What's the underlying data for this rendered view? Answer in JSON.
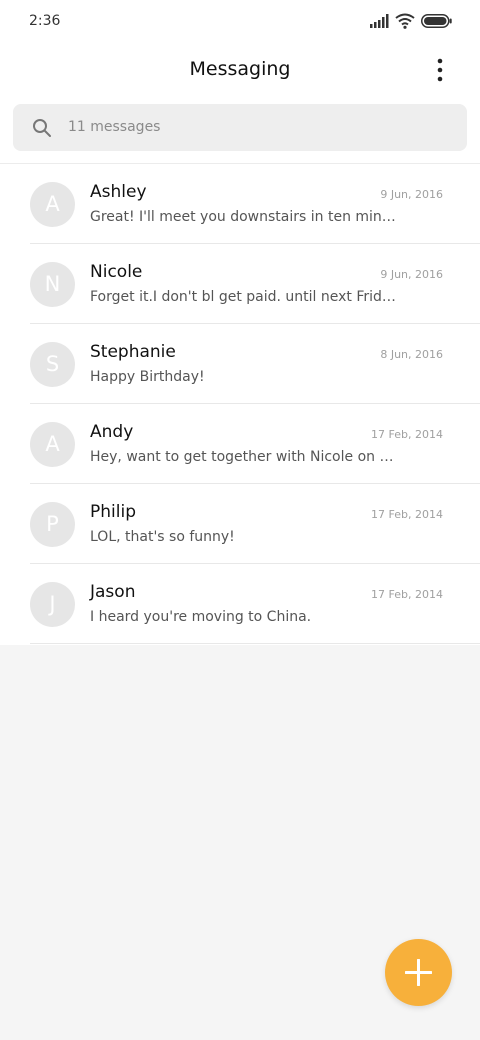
{
  "status_bar": {
    "time": "2:36"
  },
  "header": {
    "title": "Messaging",
    "more_icon": "more-vertical-icon"
  },
  "search": {
    "placeholder": "11 messages",
    "icon": "search-icon"
  },
  "conversations": [
    {
      "avatar_letter": "A",
      "name": "Ashley",
      "date": "9 Jun, 2016",
      "preview": "Great! I'll meet you downstairs in ten minutes."
    },
    {
      "avatar_letter": "N",
      "name": "Nicole",
      "date": "9 Jun, 2016",
      "preview": "Forget it.I don't bl get paid. until next Friday."
    },
    {
      "avatar_letter": "S",
      "name": "Stephanie",
      "date": "8 Jun, 2016",
      "preview": "Happy Birthday!"
    },
    {
      "avatar_letter": "A",
      "name": "Andy",
      "date": "17 Feb, 2014",
      "preview": "Hey, want to get together with Nicole on Saturday?"
    },
    {
      "avatar_letter": "P",
      "name": "Philip",
      "date": "17 Feb, 2014",
      "preview": "LOL, that's so funny!"
    },
    {
      "avatar_letter": "J",
      "name": "Jason",
      "date": "17 Feb, 2014",
      "preview": "I heard you're moving to China."
    }
  ],
  "fab": {
    "icon": "plus-icon",
    "color": "#f7b03b"
  },
  "colors": {
    "accent": "#f7b03b",
    "avatar_bg": "#e6e6e6",
    "search_bg": "#eeeeee",
    "page_bg": "#f5f5f5"
  }
}
